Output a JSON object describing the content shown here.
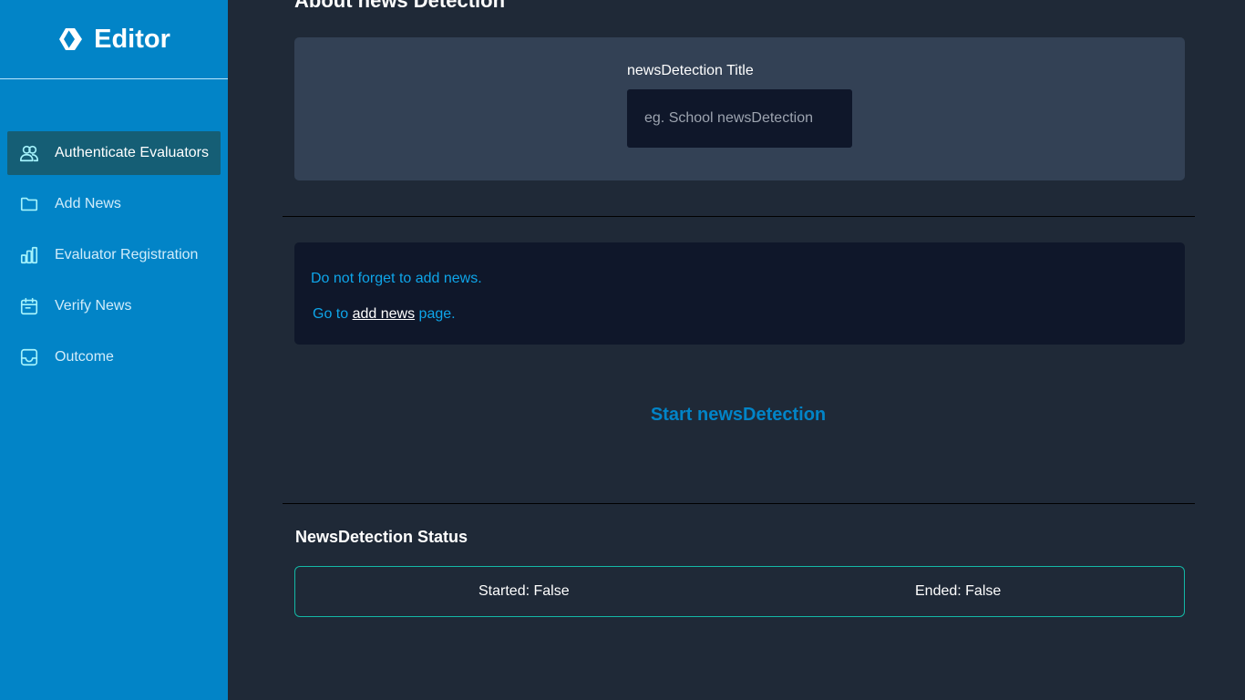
{
  "brand": {
    "name": "Editor",
    "icon": "hive-logo-icon"
  },
  "sidebar": {
    "items": [
      {
        "label": "Authenticate Evaluators",
        "icon": "users-icon",
        "active": true
      },
      {
        "label": "Add News",
        "icon": "folder-icon",
        "active": false
      },
      {
        "label": "Evaluator Registration",
        "icon": "bar-chart-icon",
        "active": false
      },
      {
        "label": "Verify News",
        "icon": "calendar-icon",
        "active": false
      },
      {
        "label": "Outcome",
        "icon": "inbox-icon",
        "active": false
      }
    ]
  },
  "main": {
    "section_title": "About news Detection",
    "title_field": {
      "label": "newsDetection Title",
      "placeholder": "eg. School newsDetection",
      "value": ""
    },
    "note": {
      "line1": "Do not forget to add news.",
      "line2_prefix": "Go to",
      "line2_link": "add news",
      "line2_suffix": "page."
    },
    "start_button": "Start newsDetection",
    "status": {
      "title": "NewsDetection Status",
      "started": "Started: False",
      "ended": "Ended: False"
    }
  },
  "colors": {
    "sidebar_bg": "#0284c7",
    "active_item_bg": "#155e75",
    "main_bg": "#1f2937",
    "card_bg": "#334155",
    "note_bg": "#0f172a",
    "accent": "#0ea5e9",
    "status_border": "#14b8a6"
  }
}
